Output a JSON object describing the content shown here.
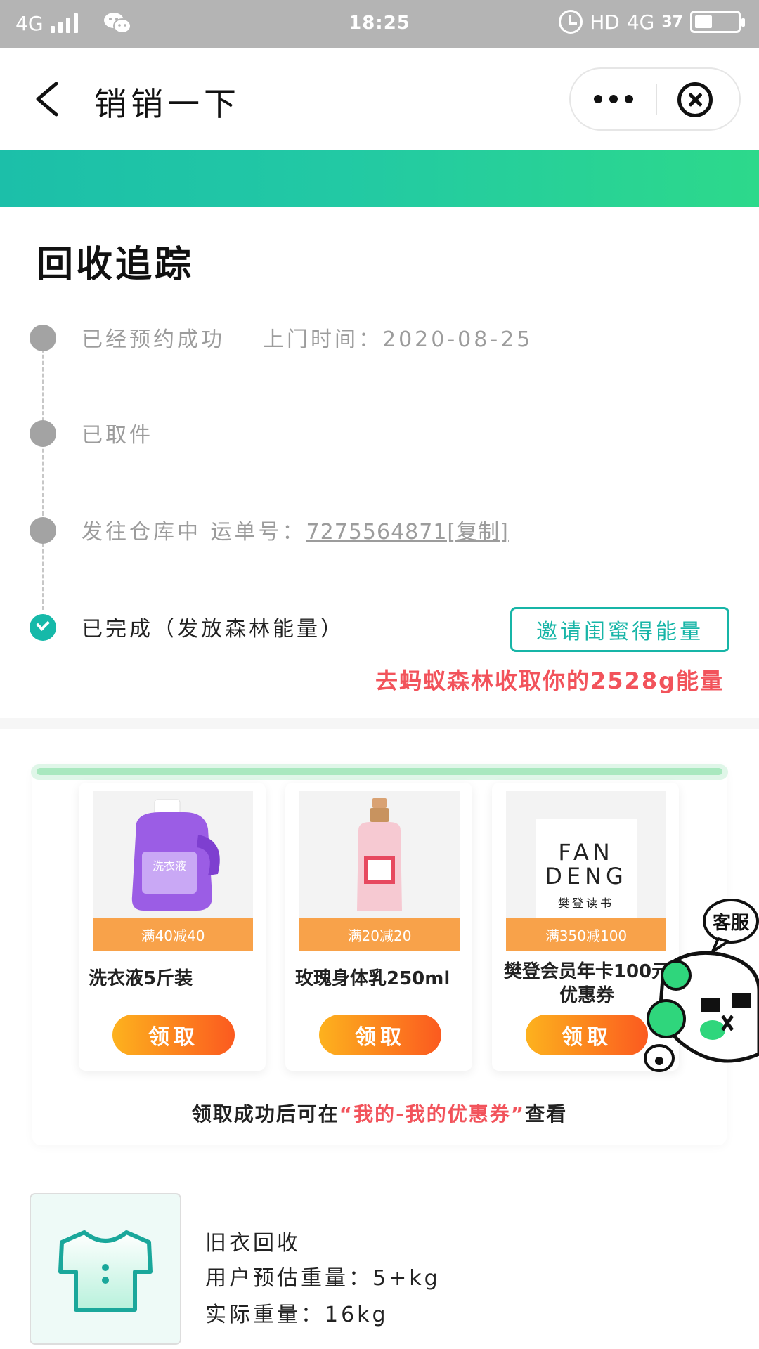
{
  "status_bar": {
    "network": "4G",
    "time": "18:25",
    "hd_label": "HD",
    "network_right": "4G",
    "battery_percent": "37"
  },
  "nav": {
    "title": "销销一下"
  },
  "tracking": {
    "title": "回收追踪",
    "steps": [
      {
        "text": "已经预约成功",
        "sub": "上门时间：2020-08-25"
      },
      {
        "text": "已取件"
      },
      {
        "text": "发往仓库中 运单号：",
        "link": "7275564871[复制]"
      },
      {
        "text": "已完成（发放森林能量）"
      }
    ],
    "invite_label": "邀请闺蜜得能量",
    "energy_link": "去蚂蚁森林收取你的2528g能量"
  },
  "coupons": {
    "items": [
      {
        "tag": "满40减40",
        "name": "洗衣液5斤装",
        "claim": "领取"
      },
      {
        "tag": "满20减20",
        "name": "玫瑰身体乳250ml",
        "claim": "领取"
      },
      {
        "tag": "满350减100",
        "name": "樊登会员年卡100元优惠券",
        "claim": "领取"
      }
    ],
    "note_prefix": "领取成功后可在",
    "note_highlight": "“我的-我的优惠券”",
    "note_suffix": "查看",
    "fandeng_logo": {
      "line1": "FAN",
      "line2": "DENG",
      "line3": "樊登读书"
    },
    "detergent_label": "洗衣液"
  },
  "service": {
    "label": "客服"
  },
  "item": {
    "name": "旧衣回收",
    "estimate": "用户预估重量：5+kg",
    "actual": "实际重量：16kg"
  },
  "colors": {
    "accent": "#17b5a7",
    "highlight": "#f2535b",
    "tag_orange": "#f8a24a"
  }
}
